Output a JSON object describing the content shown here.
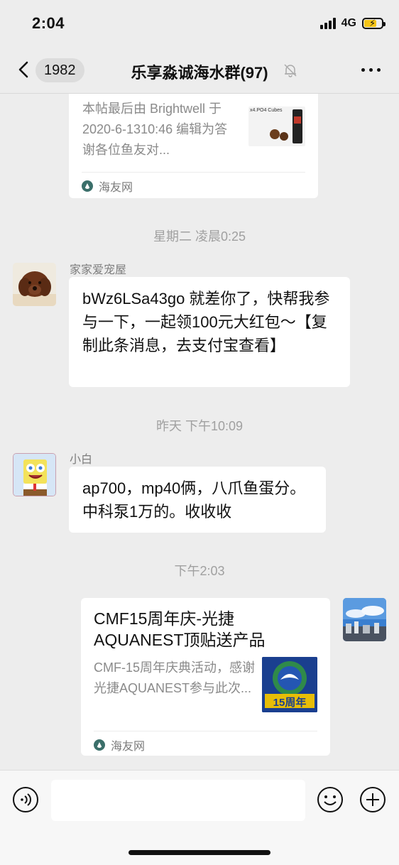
{
  "status_bar": {
    "time": "2:04",
    "network": "4G"
  },
  "nav": {
    "unread_count": "1982",
    "title": "乐享淼诚海水群(97)"
  },
  "messages": {
    "card1": {
      "desc": "本帖最后由 Brightwell 于 2020-6-1310:46 编辑为答谢各位鱼友对...",
      "thumb_text": "x4.PO4 Cubes",
      "source": "海友网"
    },
    "divider1": "星期二 凌晨0:25",
    "msg1": {
      "sender": "家家爱宠屋",
      "text": "bWz6LSa43go 就差你了，快帮我参与一下，一起领100元大红包～【复制此条消息，去支付宝查看】"
    },
    "divider2": "昨天 下午10:09",
    "msg2": {
      "sender": "小白",
      "text": "ap700，mp40俩，八爪鱼蛋分。中科泵1万的。收收收"
    },
    "divider3": "下午2:03",
    "card2": {
      "title": "CMF15周年庆-光捷AQUANEST顶贴送产品",
      "desc": "CMF-15周年庆典活动，感谢光捷AQUANEST参与此次...",
      "thumb_text": "15周年",
      "source": "海友网"
    }
  },
  "colors": {
    "background": "#ededed",
    "bubble": "#ffffff",
    "battery": "#f5c518"
  }
}
